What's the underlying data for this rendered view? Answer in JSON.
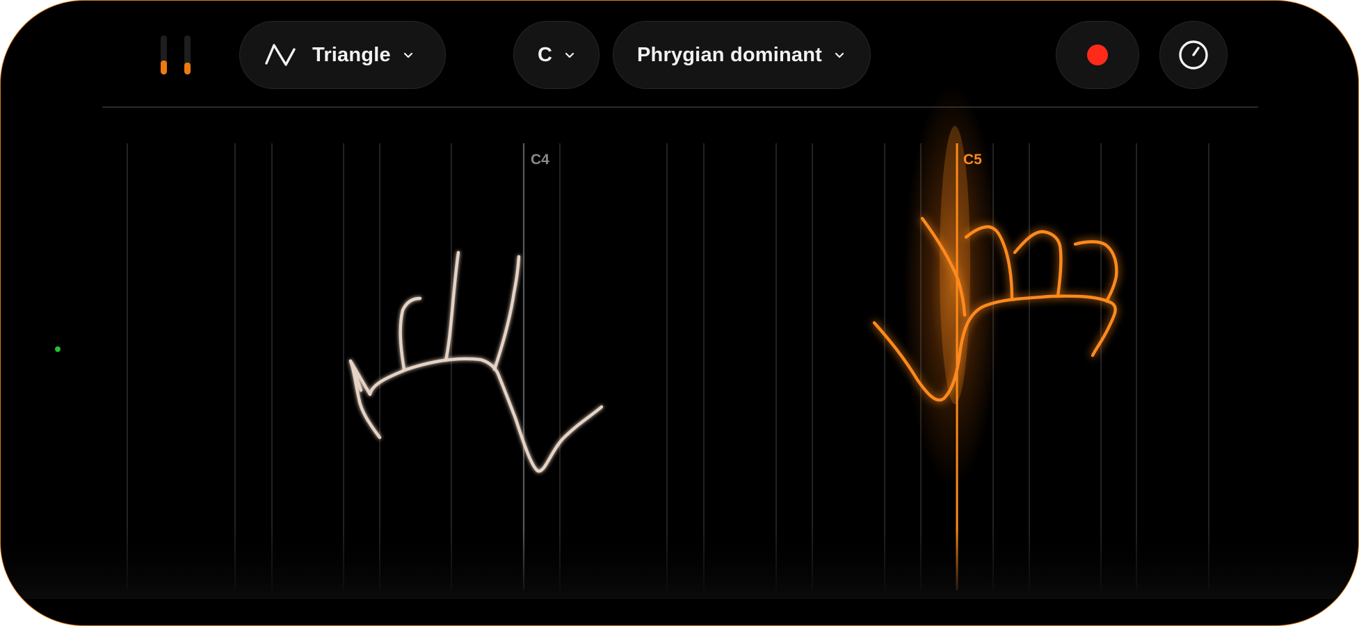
{
  "toolbar": {
    "meters": {
      "left_level": 0.35,
      "right_level": 0.3,
      "color": "#ee7a12"
    },
    "waveform": {
      "icon": "triangle-wave-icon",
      "label": "Triangle"
    },
    "key": {
      "label": "C"
    },
    "scale": {
      "label": "Phrygian dominant"
    },
    "record": {
      "icon": "record-icon",
      "color": "#ff2a1a"
    },
    "tuner": {
      "icon": "gauge-icon"
    }
  },
  "status": {
    "indicator_color": "#22c033"
  },
  "keyboard": {
    "note_labels": [
      {
        "text": "C4",
        "active": false
      },
      {
        "text": "C5",
        "active": true
      }
    ],
    "accent_color": "#ff8a1a",
    "inactive_label_color": "#8a8a8a"
  },
  "hands": {
    "left": {
      "state": "open",
      "color": "#e6d3c4"
    },
    "right": {
      "state": "fist",
      "color": "#ff8a1a"
    }
  }
}
